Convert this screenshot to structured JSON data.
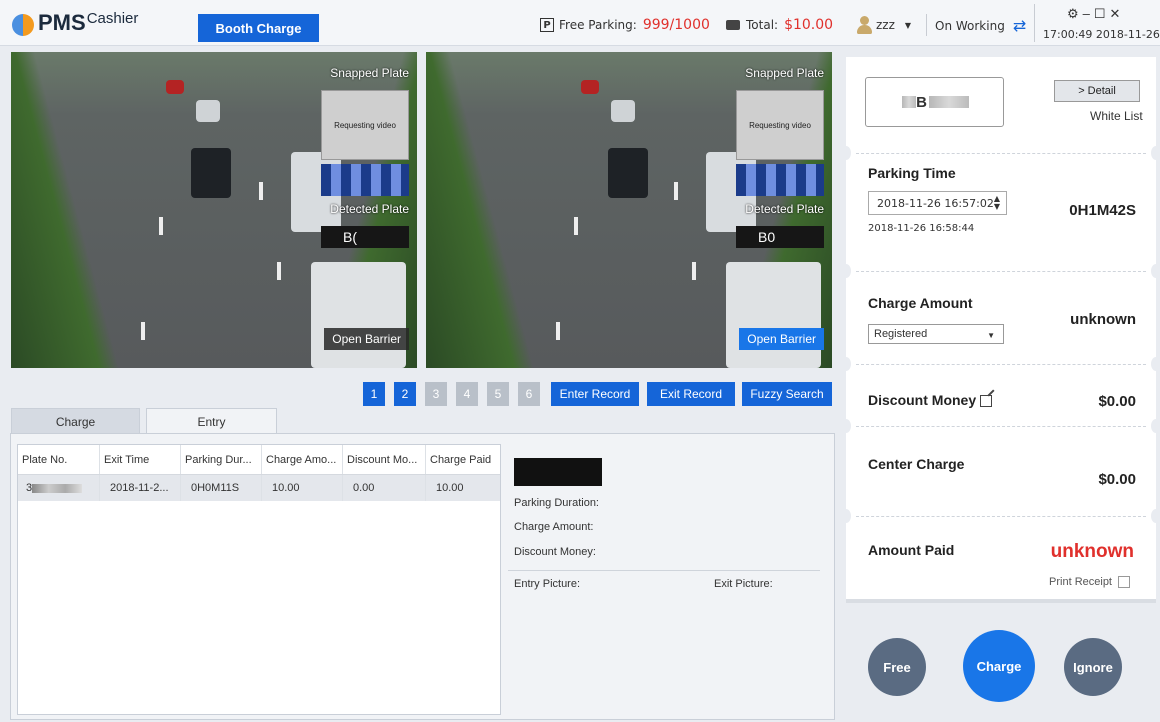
{
  "header": {
    "logo_main": "PMS",
    "logo_sub": "Cashier",
    "booth_label": "Booth Charge",
    "free_parking_label": "Free Parking:",
    "free_parking_value": "999/1000",
    "total_label": "Total:",
    "total_value": "$10.00",
    "user": "zzz",
    "status": "On Working",
    "window_controls": [
      "⚙",
      "–",
      "☐",
      "✕"
    ],
    "datetime": "17:00:49 2018-11-26"
  },
  "video": {
    "snapped_plate_label": "Snapped Plate",
    "requesting_label": "Requesting video",
    "detected_plate_label": "Detected Plate",
    "left_detected": "B(",
    "right_detected": "B0",
    "open_barrier_label": "Open Barrier"
  },
  "pager": {
    "pages": [
      "1",
      "2",
      "3",
      "4",
      "5",
      "6"
    ],
    "enter_record": "Enter Record",
    "exit_record": "Exit Record",
    "fuzzy_search": "Fuzzy Search"
  },
  "tabs": {
    "charge": "Charge",
    "entry": "Entry"
  },
  "table": {
    "headers": [
      "Plate No.",
      "Exit Time",
      "Parking Dur...",
      "Charge Amo...",
      "Discount Mo...",
      "Charge Paid"
    ],
    "rows": [
      {
        "plate": "3",
        "exit_time": "2018-11-2...",
        "duration": "0H0M11S",
        "charge": "10.00",
        "discount": "0.00",
        "paid": "10.00"
      }
    ]
  },
  "detail_pane": {
    "parking_duration": "Parking Duration:",
    "charge_amount": "Charge Amount:",
    "discount_money": "Discount Money:",
    "entry_picture": "Entry Picture:",
    "exit_picture": "Exit Picture:"
  },
  "right_panel": {
    "plate_prefix": "B",
    "detail_btn": "> Detail",
    "white_list": "White List",
    "parking_time_label": "Parking Time",
    "entry_time": "2018-11-26 16:57:02",
    "exit_time": "2018-11-26 16:58:44",
    "parking_duration": "0H1M42S",
    "charge_amount_label": "Charge Amount",
    "charge_type": "Registered",
    "charge_amount_value": "unknown",
    "discount_label": "Discount Money",
    "discount_value": "$0.00",
    "center_charge_label": "Center Charge",
    "center_charge_value": "$0.00",
    "amount_paid_label": "Amount Paid",
    "amount_paid_value": "unknown",
    "print_receipt": "Print Receipt"
  },
  "actions": {
    "free": "Free",
    "charge": "Charge",
    "ignore": "Ignore"
  },
  "colors": {
    "accent": "#1565d8",
    "alert": "#e0302c",
    "action_gray": "#5a6b82"
  }
}
